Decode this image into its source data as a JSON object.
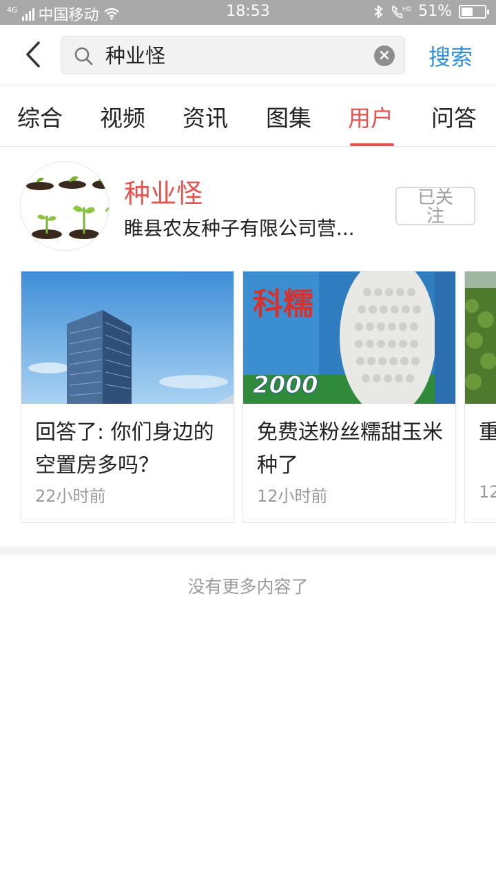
{
  "status_bar": {
    "network": "4G",
    "carrier": "中国移动",
    "time": "18:53",
    "battery": "51%",
    "battery_level": 0.51,
    "icons": [
      "signal-icon",
      "wifi-icon",
      "bluetooth-icon",
      "hd-call-icon",
      "battery-icon"
    ]
  },
  "search": {
    "query": "种业怪",
    "button_label": "搜索"
  },
  "tabs": [
    {
      "label": "综合"
    },
    {
      "label": "视频"
    },
    {
      "label": "资讯"
    },
    {
      "label": "图集"
    },
    {
      "label": "用户",
      "active": true
    },
    {
      "label": "问答"
    }
  ],
  "user": {
    "name": "种业怪",
    "description": "睢县农友种子有限公司营...",
    "follow_label": "已关注"
  },
  "cards": [
    {
      "title": "回答了: 你们身边的空置房多吗？",
      "time": "22小时前",
      "thumb": "building-photo"
    },
    {
      "title": "免费送粉丝糯甜玉米种了",
      "time": "12小时前",
      "thumb": "corn-seed-photo",
      "thumb_text": {
        "brand": "科糯",
        "number": "2000"
      }
    },
    {
      "title": "重种",
      "time": "12",
      "thumb": "field-photo"
    }
  ],
  "footer": {
    "no_more": "没有更多内容了"
  },
  "colors": {
    "accent_red": "#e7544f",
    "link_blue": "#2d8fe0",
    "status_bar_bg": "#a9a9a9"
  }
}
